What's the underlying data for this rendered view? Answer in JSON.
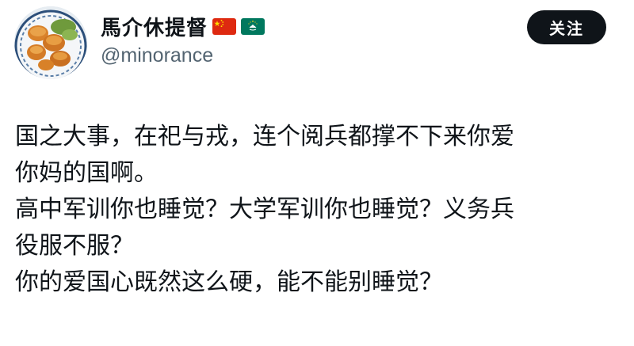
{
  "author": {
    "display_name": "馬介休提督",
    "handle": "@minorance",
    "flags": [
      "china-flag",
      "macau-flag"
    ],
    "avatar_icon": "food-plate-avatar"
  },
  "follow_button": {
    "label": "关注"
  },
  "tweet": {
    "lines": [
      "国之大事，在祀与戎，连个阅兵都撑不下来你爱",
      "你妈的国啊。",
      "高中军训你也睡觉？大学军训你也睡觉？义务兵",
      "役服不服？",
      "你的爱国心既然这么硬，能不能别睡觉？"
    ]
  },
  "colors": {
    "text_primary": "#0f1419",
    "text_secondary": "#536471",
    "button_bg": "#0f1419",
    "button_text": "#ffffff",
    "background": "#ffffff"
  }
}
